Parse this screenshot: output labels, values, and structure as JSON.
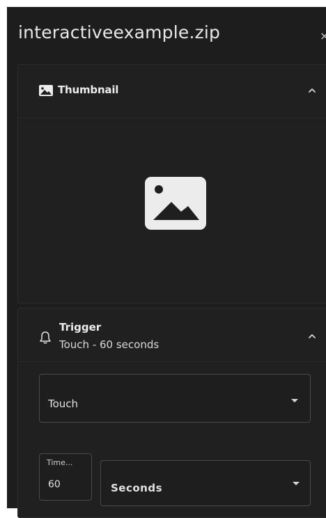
{
  "window": {
    "title": "interactiveexample.zip",
    "close_glyph": "×"
  },
  "thumbnail": {
    "label": "Thumbnail",
    "header_icon": "image-icon",
    "placeholder_icon": "image-placeholder-icon",
    "expanded": true
  },
  "trigger": {
    "label": "Trigger",
    "summary": "Touch - 60 seconds",
    "header_icon": "bell-icon",
    "expanded": true,
    "type_select": {
      "value": "Touch"
    },
    "time": {
      "label": "Time...",
      "value": "60"
    },
    "unit_select": {
      "value": "Seconds"
    }
  },
  "colors": {
    "panel_bg": "#1d1d1d",
    "section_bg": "#202020",
    "text": "#e6e6e6",
    "border": "#4a4a4a"
  }
}
